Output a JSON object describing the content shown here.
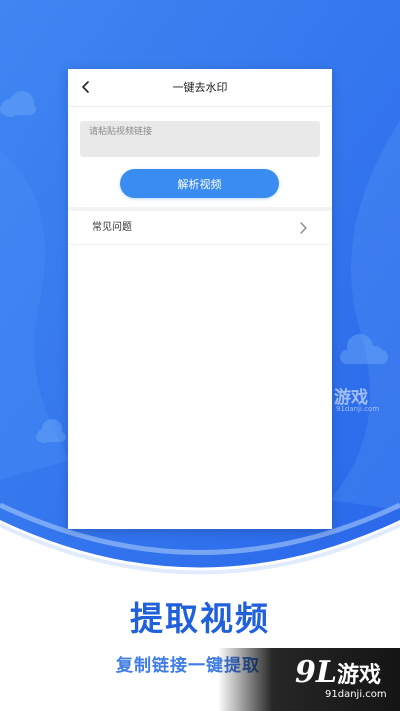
{
  "colors": {
    "brand_blue": "#2d6ff0",
    "button_blue": "#3b8cf1",
    "caption_blue": "#2160db"
  },
  "header": {
    "title": "一键去水印",
    "back_icon": "chevron-left-icon"
  },
  "link_input": {
    "placeholder": "请粘贴视频链接",
    "value": ""
  },
  "parse_button": {
    "label": "解析视频"
  },
  "faq": {
    "label": "常见问题",
    "chevron_icon": "chevron-right-icon"
  },
  "watermark": {
    "logo_number": "9L",
    "logo_text": "游戏",
    "domain": "91danji.com"
  },
  "caption": {
    "title": "提取视频",
    "subtitle": "复制链接一键提取"
  }
}
